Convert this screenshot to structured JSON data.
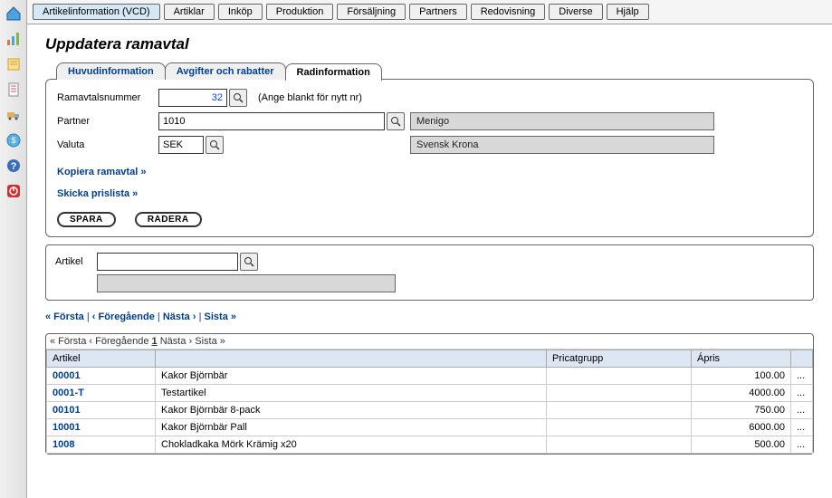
{
  "menubar": [
    {
      "label": "Artikelinformation (VCD)",
      "active": true
    },
    {
      "label": "Artiklar"
    },
    {
      "label": "Inköp"
    },
    {
      "label": "Produktion"
    },
    {
      "label": "Försäljning"
    },
    {
      "label": "Partners"
    },
    {
      "label": "Redovisning"
    },
    {
      "label": "Diverse"
    },
    {
      "label": "Hjälp"
    }
  ],
  "page_title": "Uppdatera ramavtal",
  "tabs": [
    {
      "label": "Huvudinformation"
    },
    {
      "label": "Avgifter och rabatter"
    },
    {
      "label": "Radinformation",
      "active": true
    }
  ],
  "form": {
    "ramavtalsnummer_label": "Ramavtalsnummer",
    "ramavtalsnummer_value": "32",
    "ramavtalsnummer_hint": "(Ange blankt för nytt nr)",
    "partner_label": "Partner",
    "partner_value": "1010",
    "partner_name": "Menigo",
    "valuta_label": "Valuta",
    "valuta_value": "SEK",
    "valuta_name": "Svensk Krona"
  },
  "links": {
    "kopiera": "Kopiera ramavtal »",
    "skicka": "Skicka prislista »"
  },
  "buttons": {
    "spara": "SPARA",
    "radera": "RADERA"
  },
  "artikel_label": "Artikel",
  "pager": {
    "first": "« Första",
    "prev": "‹ Föregående",
    "next": "Nästa ›",
    "last": "Sista »",
    "sep": " | "
  },
  "table_pager": {
    "first": "« Första",
    "prev": "‹ Föregående",
    "page": "1",
    "next": "Nästa ›",
    "last": "Sista »"
  },
  "table": {
    "headers": [
      "Artikel",
      "",
      "Pricatgrupp",
      "Ápris",
      ""
    ],
    "rows": [
      {
        "artikel": "00001",
        "name": "Kakor Björnbär",
        "pricat": "",
        "apris": "100.00",
        "more": "..."
      },
      {
        "artikel": "0001-T",
        "name": "Testartikel",
        "pricat": "",
        "apris": "4000.00",
        "more": "..."
      },
      {
        "artikel": "00101",
        "name": "Kakor Björnbär 8-pack",
        "pricat": "",
        "apris": "750.00",
        "more": "..."
      },
      {
        "artikel": "10001",
        "name": "Kakor Björnbär Pall",
        "pricat": "",
        "apris": "6000.00",
        "more": "..."
      },
      {
        "artikel": "1008",
        "name": "Chokladkaka Mörk Krämig x20",
        "pricat": "",
        "apris": "500.00",
        "more": "..."
      }
    ]
  }
}
